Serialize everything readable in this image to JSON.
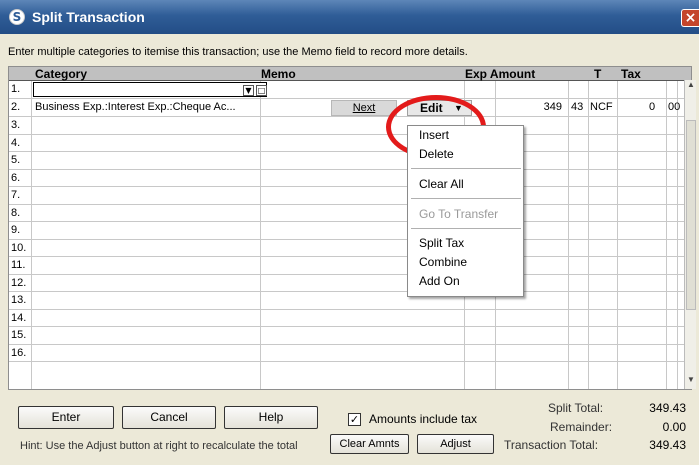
{
  "window": {
    "title": "Split Transaction",
    "close_glyph": "×",
    "app_icon": "S"
  },
  "instructions": "Enter multiple categories to itemise this transaction; use the Memo field to record more details.",
  "columns": {
    "category": "Category",
    "memo": "Memo",
    "exp_amount": "Exp Amount",
    "t": "T",
    "tax": "Tax"
  },
  "rows": [
    {
      "num": "1.",
      "category": "",
      "amount_major": "",
      "amount_minor": "",
      "t": "",
      "tax_major": "",
      "tax_minor": ""
    },
    {
      "num": "2.",
      "category": "Business Exp.:Interest Exp.:Cheque Ac...",
      "amount_major": "349",
      "amount_minor": "43",
      "t": "NCF",
      "tax_major": "0",
      "tax_minor": "00"
    },
    {
      "num": "3."
    },
    {
      "num": "4."
    },
    {
      "num": "5."
    },
    {
      "num": "6."
    },
    {
      "num": "7."
    },
    {
      "num": "8."
    },
    {
      "num": "9."
    },
    {
      "num": "10."
    },
    {
      "num": "11."
    },
    {
      "num": "12."
    },
    {
      "num": "13."
    },
    {
      "num": "14."
    },
    {
      "num": "15."
    },
    {
      "num": "16."
    }
  ],
  "row_buttons": {
    "next": "Next",
    "edit": "Edit",
    "edit_caret": "▼"
  },
  "edit_menu": {
    "insert": "Insert",
    "delete": "Delete",
    "clear_all": "Clear All",
    "go_to_transfer": "Go To Transfer",
    "split_tax": "Split Tax",
    "combine": "Combine",
    "add_on": "Add On"
  },
  "buttons": {
    "enter": "Enter",
    "cancel": "Cancel",
    "help": "Help",
    "clear_amnts": "Clear Amnts",
    "adjust": "Adjust"
  },
  "amounts_include_tax": {
    "label": "Amounts include tax",
    "checked": true,
    "check_glyph": "✓"
  },
  "totals": {
    "split_total_label": "Split Total:",
    "split_total": "349.43",
    "remainder_label": "Remainder:",
    "remainder": "0.00",
    "transaction_total_label": "Transaction Total:",
    "transaction_total": "349.43"
  },
  "hint": "Hint: Use the Adjust button at right to recalculate the total",
  "colors": {
    "title_bar": "#2f5d97",
    "highlight_circle": "#e31b1b",
    "dialog_bg": "#ece9d8"
  }
}
